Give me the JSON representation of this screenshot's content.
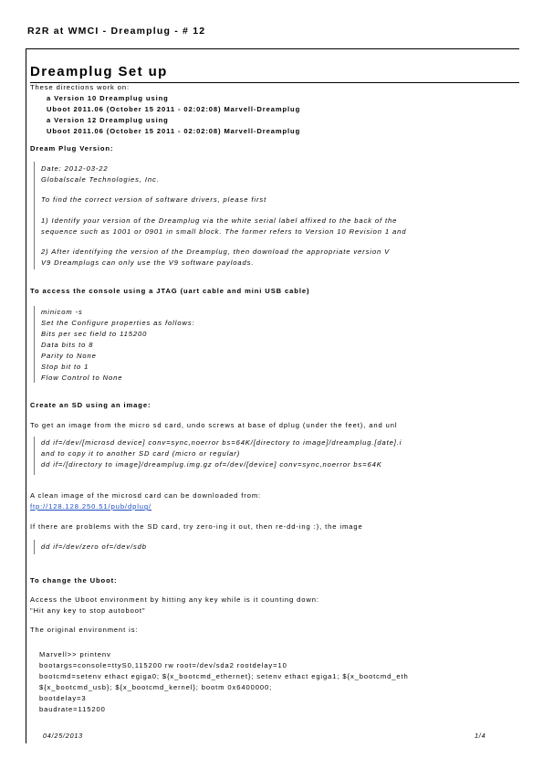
{
  "header": {
    "title": "R2R at WMCI - Dreamplug - # 12"
  },
  "page": {
    "title": "Dreamplug Set up",
    "intro": "These directions work on:",
    "versions": [
      "a Version 10 Dreamplug using",
      "Uboot 2011.06 (October 15 2011 - 02:02:08) Marvell-Dreamplug",
      "a Version 12 Dreamplug using",
      "Uboot 2011.06 (October 15 2011 - 02:02:08) Marvell-Dreamplug"
    ]
  },
  "version_section": {
    "heading": "Dream Plug Version:",
    "lines": [
      "Date: 2012-03-22",
      "Globalscale Technologies, Inc.",
      "To find the correct version of software drivers, please first",
      "1) Identify your version of the Dreamplug via the white serial label affixed to the back of the",
      "sequence such as 1001 or 0901 in small block. The former refers to Version 10 Revision 1 and",
      "2) After identifying the version of the Dreamplug, then download the appropriate version V",
      "V9 Dreamplugs can only use the V9 software payloads."
    ]
  },
  "console_section": {
    "heading": "To access the console using a JTAG (uart cable and mini USB cable)",
    "lines": [
      "minicom -s",
      "Set the Configure properties as follows:",
      "Bits per sec field to 115200",
      "Data bits to 8",
      "Parity to None",
      "Stop bit to 1",
      "Flow Control to None"
    ]
  },
  "sd_section": {
    "heading": "Create an SD using an image:",
    "intro": "To get an image from the micro sd card, undo screws at base of dplug (under the feet), and unl",
    "code": [
      "dd if=/dev/[microsd device] conv=sync,noerror bs=64K/[directory to image]/dreamplug.[date].i",
      "and to copy it to another SD card (micro or regular)",
      "dd if=/[directory to image]/dreamplug.img.gz of=/dev/[device] conv=sync,noerror bs=64K"
    ],
    "download_text": "A clean image of the microsd card can be downloaded from:",
    "download_link": "ftp://128.128.250.51/pub/dplug/",
    "problems_text": "If there are problems with the SD card, try zero-ing it out, then re-dd-ing :), the image",
    "zero_code": "dd if=/dev/zero of=/dev/sdb"
  },
  "uboot_section": {
    "heading": "To change the Uboot:",
    "access_text": "Access the Uboot environment by hitting any key while is it counting down:",
    "quote": "\"Hit any key to stop autoboot\"",
    "original_text": "The original environment is:",
    "env_lines": [
      "Marvell>> printenv",
      "bootargs=console=ttyS0,115200 rw root=/dev/sda2 rootdelay=10",
      "bootcmd=setenv ethact egiga0; ${x_bootcmd_ethernet}; setenv ethact egiga1; ${x_bootcmd_eth",
      "${x_bootcmd_usb}; ${x_bootcmd_kernel}; bootm 0x6400000;",
      "bootdelay=3",
      "baudrate=115200"
    ]
  },
  "footer": {
    "date": "04/25/2013",
    "page": "1/4"
  }
}
